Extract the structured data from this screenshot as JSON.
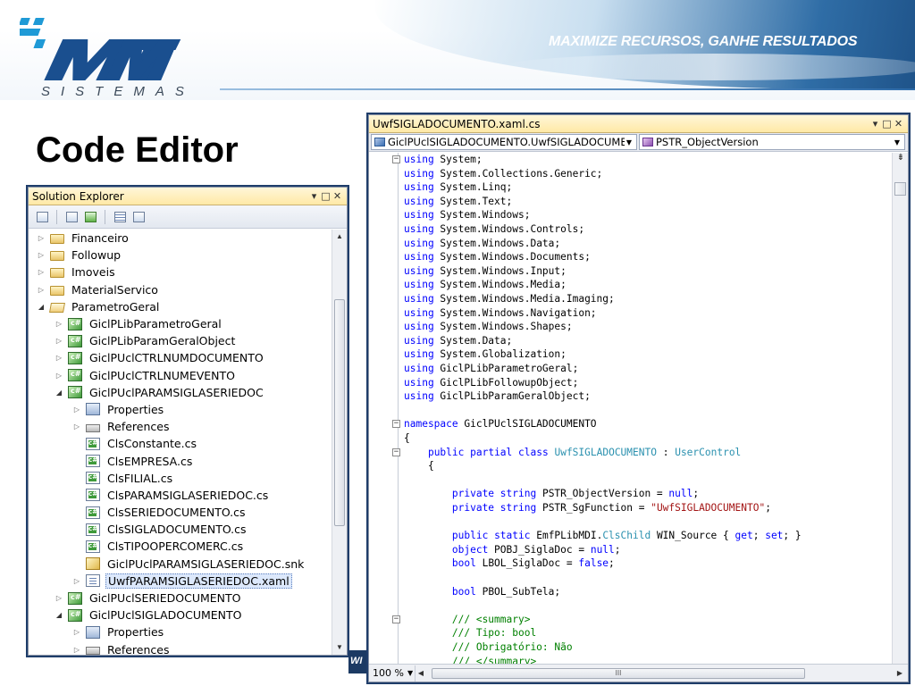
{
  "slide": {
    "tagline": "MAXIMIZE RECURSOS, GANHE RESULTADOS",
    "logo_text": "MTM",
    "logo_sub": "SISTEMAS",
    "title": "Code Editor",
    "footer_fragment": "WI"
  },
  "solution_explorer": {
    "title": "Solution Explorer",
    "window_buttons": [
      "▾",
      "□",
      "✕"
    ],
    "toolbar_icons": [
      "properties-icon",
      "show-all-files-icon",
      "refresh-icon",
      "view-code-icon",
      "view-designer-icon"
    ],
    "items": [
      {
        "label": "Financeiro",
        "icon": "folder",
        "indent": 0,
        "arrow": "▷"
      },
      {
        "label": "Followup",
        "icon": "folder",
        "indent": 0,
        "arrow": "▷"
      },
      {
        "label": "Imoveis",
        "icon": "folder",
        "indent": 0,
        "arrow": "▷"
      },
      {
        "label": "MaterialServico",
        "icon": "folder",
        "indent": 0,
        "arrow": "▷"
      },
      {
        "label": "ParametroGeral",
        "icon": "folder-open",
        "indent": 0,
        "arrow": "◢"
      },
      {
        "label": "GiclPLibParametroGeral",
        "icon": "cs-proj",
        "indent": 1,
        "arrow": "▷"
      },
      {
        "label": "GiclPLibParamGeralObject",
        "icon": "cs-proj",
        "indent": 1,
        "arrow": "▷"
      },
      {
        "label": "GiclPUclCTRLNUMDOCUMENTO",
        "icon": "cs-proj",
        "indent": 1,
        "arrow": "▷"
      },
      {
        "label": "GiclPUclCTRLNUMEVENTO",
        "icon": "cs-proj",
        "indent": 1,
        "arrow": "▷"
      },
      {
        "label": "GiclPUclPARAMSIGLASERIEDOC",
        "icon": "cs-proj",
        "indent": 1,
        "arrow": "◢"
      },
      {
        "label": "Properties",
        "icon": "props",
        "indent": 2,
        "arrow": "▷"
      },
      {
        "label": "References",
        "icon": "refs",
        "indent": 2,
        "arrow": "▷"
      },
      {
        "label": "ClsConstante.cs",
        "icon": "cs-file",
        "indent": 2,
        "arrow": ""
      },
      {
        "label": "ClsEMPRESA.cs",
        "icon": "cs-file",
        "indent": 2,
        "arrow": ""
      },
      {
        "label": "ClsFILIAL.cs",
        "icon": "cs-file",
        "indent": 2,
        "arrow": ""
      },
      {
        "label": "ClsPARAMSIGLASERIEDOC.cs",
        "icon": "cs-file",
        "indent": 2,
        "arrow": ""
      },
      {
        "label": "ClsSERIEDOCUMENTO.cs",
        "icon": "cs-file",
        "indent": 2,
        "arrow": ""
      },
      {
        "label": "ClsSIGLADOCUMENTO.cs",
        "icon": "cs-file",
        "indent": 2,
        "arrow": ""
      },
      {
        "label": "ClsTIPOOPERCOMERC.cs",
        "icon": "cs-file",
        "indent": 2,
        "arrow": ""
      },
      {
        "label": "GiclPUclPARAMSIGLASERIEDOC.snk",
        "icon": "snk",
        "indent": 2,
        "arrow": ""
      },
      {
        "label": "UwfPARAMSIGLASERIEDOC.xaml",
        "icon": "xaml",
        "indent": 2,
        "arrow": "▷",
        "selected": true
      },
      {
        "label": "GiclPUclSERIEDOCUMENTO",
        "icon": "cs-proj",
        "indent": 1,
        "arrow": "▷"
      },
      {
        "label": "GiclPUclSIGLADOCUMENTO",
        "icon": "cs-proj",
        "indent": 1,
        "arrow": "◢"
      },
      {
        "label": "Properties",
        "icon": "props",
        "indent": 2,
        "arrow": "▷"
      },
      {
        "label": "References",
        "icon": "refs",
        "indent": 2,
        "arrow": "▷"
      }
    ]
  },
  "code_editor": {
    "title": "UwfSIGLADOCUMENTO.xaml.cs",
    "window_buttons": [
      "▾",
      "□",
      "✕"
    ],
    "type_combo": "GiclPUclSIGLADOCUMENTO.UwfSIGLADOCUMENT",
    "member_combo": "PSTR_ObjectVersion",
    "zoom": "100 %",
    "lines": [
      {
        "fold": "−",
        "tokens": [
          [
            "kw",
            "using"
          ],
          [
            "",
            " System;"
          ]
        ]
      },
      {
        "tokens": [
          [
            "kw",
            "using"
          ],
          [
            "",
            " System.Collections.Generic;"
          ]
        ]
      },
      {
        "tokens": [
          [
            "kw",
            "using"
          ],
          [
            "",
            " System.Linq;"
          ]
        ]
      },
      {
        "tokens": [
          [
            "kw",
            "using"
          ],
          [
            "",
            " System.Text;"
          ]
        ]
      },
      {
        "tokens": [
          [
            "kw",
            "using"
          ],
          [
            "",
            " System.Windows;"
          ]
        ]
      },
      {
        "tokens": [
          [
            "kw",
            "using"
          ],
          [
            "",
            " System.Windows.Controls;"
          ]
        ]
      },
      {
        "tokens": [
          [
            "kw",
            "using"
          ],
          [
            "",
            " System.Windows.Data;"
          ]
        ]
      },
      {
        "tokens": [
          [
            "kw",
            "using"
          ],
          [
            "",
            " System.Windows.Documents;"
          ]
        ]
      },
      {
        "tokens": [
          [
            "kw",
            "using"
          ],
          [
            "",
            " System.Windows.Input;"
          ]
        ]
      },
      {
        "tokens": [
          [
            "kw",
            "using"
          ],
          [
            "",
            " System.Windows.Media;"
          ]
        ]
      },
      {
        "tokens": [
          [
            "kw",
            "using"
          ],
          [
            "",
            " System.Windows.Media.Imaging;"
          ]
        ]
      },
      {
        "tokens": [
          [
            "kw",
            "using"
          ],
          [
            "",
            " System.Windows.Navigation;"
          ]
        ]
      },
      {
        "tokens": [
          [
            "kw",
            "using"
          ],
          [
            "",
            " System.Windows.Shapes;"
          ]
        ]
      },
      {
        "tokens": [
          [
            "kw",
            "using"
          ],
          [
            "",
            " System.Data;"
          ]
        ]
      },
      {
        "tokens": [
          [
            "kw",
            "using"
          ],
          [
            "",
            " System.Globalization;"
          ]
        ]
      },
      {
        "tokens": [
          [
            "kw",
            "using"
          ],
          [
            "",
            " GiclPLibParametroGeral;"
          ]
        ]
      },
      {
        "tokens": [
          [
            "kw",
            "using"
          ],
          [
            "",
            " GiclPLibFollowupObject;"
          ]
        ]
      },
      {
        "tokens": [
          [
            "kw",
            "using"
          ],
          [
            "",
            " GiclPLibParamGeralObject;"
          ]
        ]
      },
      {
        "tokens": []
      },
      {
        "fold": "−",
        "tokens": [
          [
            "kw",
            "namespace"
          ],
          [
            "",
            " GiclPUclSIGLADOCUMENTO"
          ]
        ]
      },
      {
        "tokens": [
          [
            "",
            "{"
          ]
        ]
      },
      {
        "fold": "−",
        "tokens": [
          [
            "",
            "    "
          ],
          [
            "kw",
            "public"
          ],
          [
            "",
            " "
          ],
          [
            "kw",
            "partial"
          ],
          [
            "",
            " "
          ],
          [
            "kw",
            "class"
          ],
          [
            "",
            " "
          ],
          [
            "ty",
            "UwfSIGLADOCUMENTO"
          ],
          [
            "",
            " : "
          ],
          [
            "ty",
            "UserControl"
          ]
        ]
      },
      {
        "tokens": [
          [
            "",
            "    {"
          ]
        ]
      },
      {
        "tokens": []
      },
      {
        "tokens": [
          [
            "",
            "        "
          ],
          [
            "kw",
            "private"
          ],
          [
            "",
            " "
          ],
          [
            "kw",
            "string"
          ],
          [
            "",
            " PSTR_ObjectVersion = "
          ],
          [
            "kw",
            "null"
          ],
          [
            "",
            ";"
          ]
        ]
      },
      {
        "tokens": [
          [
            "",
            "        "
          ],
          [
            "kw",
            "private"
          ],
          [
            "",
            " "
          ],
          [
            "kw",
            "string"
          ],
          [
            "",
            " PSTR_SgFunction = "
          ],
          [
            "st",
            "\"UwfSIGLADOCUMENTO\""
          ],
          [
            "",
            ";"
          ]
        ]
      },
      {
        "tokens": []
      },
      {
        "tokens": [
          [
            "",
            "        "
          ],
          [
            "kw",
            "public"
          ],
          [
            "",
            " "
          ],
          [
            "kw",
            "static"
          ],
          [
            "",
            " EmfPLibMDI."
          ],
          [
            "ty",
            "ClsChild"
          ],
          [
            "",
            " WIN_Source { "
          ],
          [
            "kw",
            "get"
          ],
          [
            "",
            "; "
          ],
          [
            "kw",
            "set"
          ],
          [
            "",
            "; }"
          ]
        ]
      },
      {
        "tokens": [
          [
            "",
            "        "
          ],
          [
            "kw",
            "object"
          ],
          [
            "",
            " POBJ_SiglaDoc = "
          ],
          [
            "kw",
            "null"
          ],
          [
            "",
            ";"
          ]
        ]
      },
      {
        "tokens": [
          [
            "",
            "        "
          ],
          [
            "kw",
            "bool"
          ],
          [
            "",
            " LBOL_SiglaDoc = "
          ],
          [
            "kw",
            "false"
          ],
          [
            "",
            ";"
          ]
        ]
      },
      {
        "tokens": []
      },
      {
        "tokens": [
          [
            "",
            "        "
          ],
          [
            "kw",
            "bool"
          ],
          [
            "",
            " PBOL_SubTela;"
          ]
        ]
      },
      {
        "tokens": []
      },
      {
        "fold": "−",
        "tokens": [
          [
            "",
            "        "
          ],
          [
            "cm",
            "/// <summary>"
          ]
        ]
      },
      {
        "tokens": [
          [
            "",
            "        "
          ],
          [
            "cm",
            "/// Tipo: bool"
          ]
        ]
      },
      {
        "tokens": [
          [
            "",
            "        "
          ],
          [
            "cm",
            "/// Obrigatório: Não"
          ]
        ]
      },
      {
        "tokens": [
          [
            "",
            "        "
          ],
          [
            "cm",
            "/// </summary>"
          ]
        ]
      }
    ]
  }
}
